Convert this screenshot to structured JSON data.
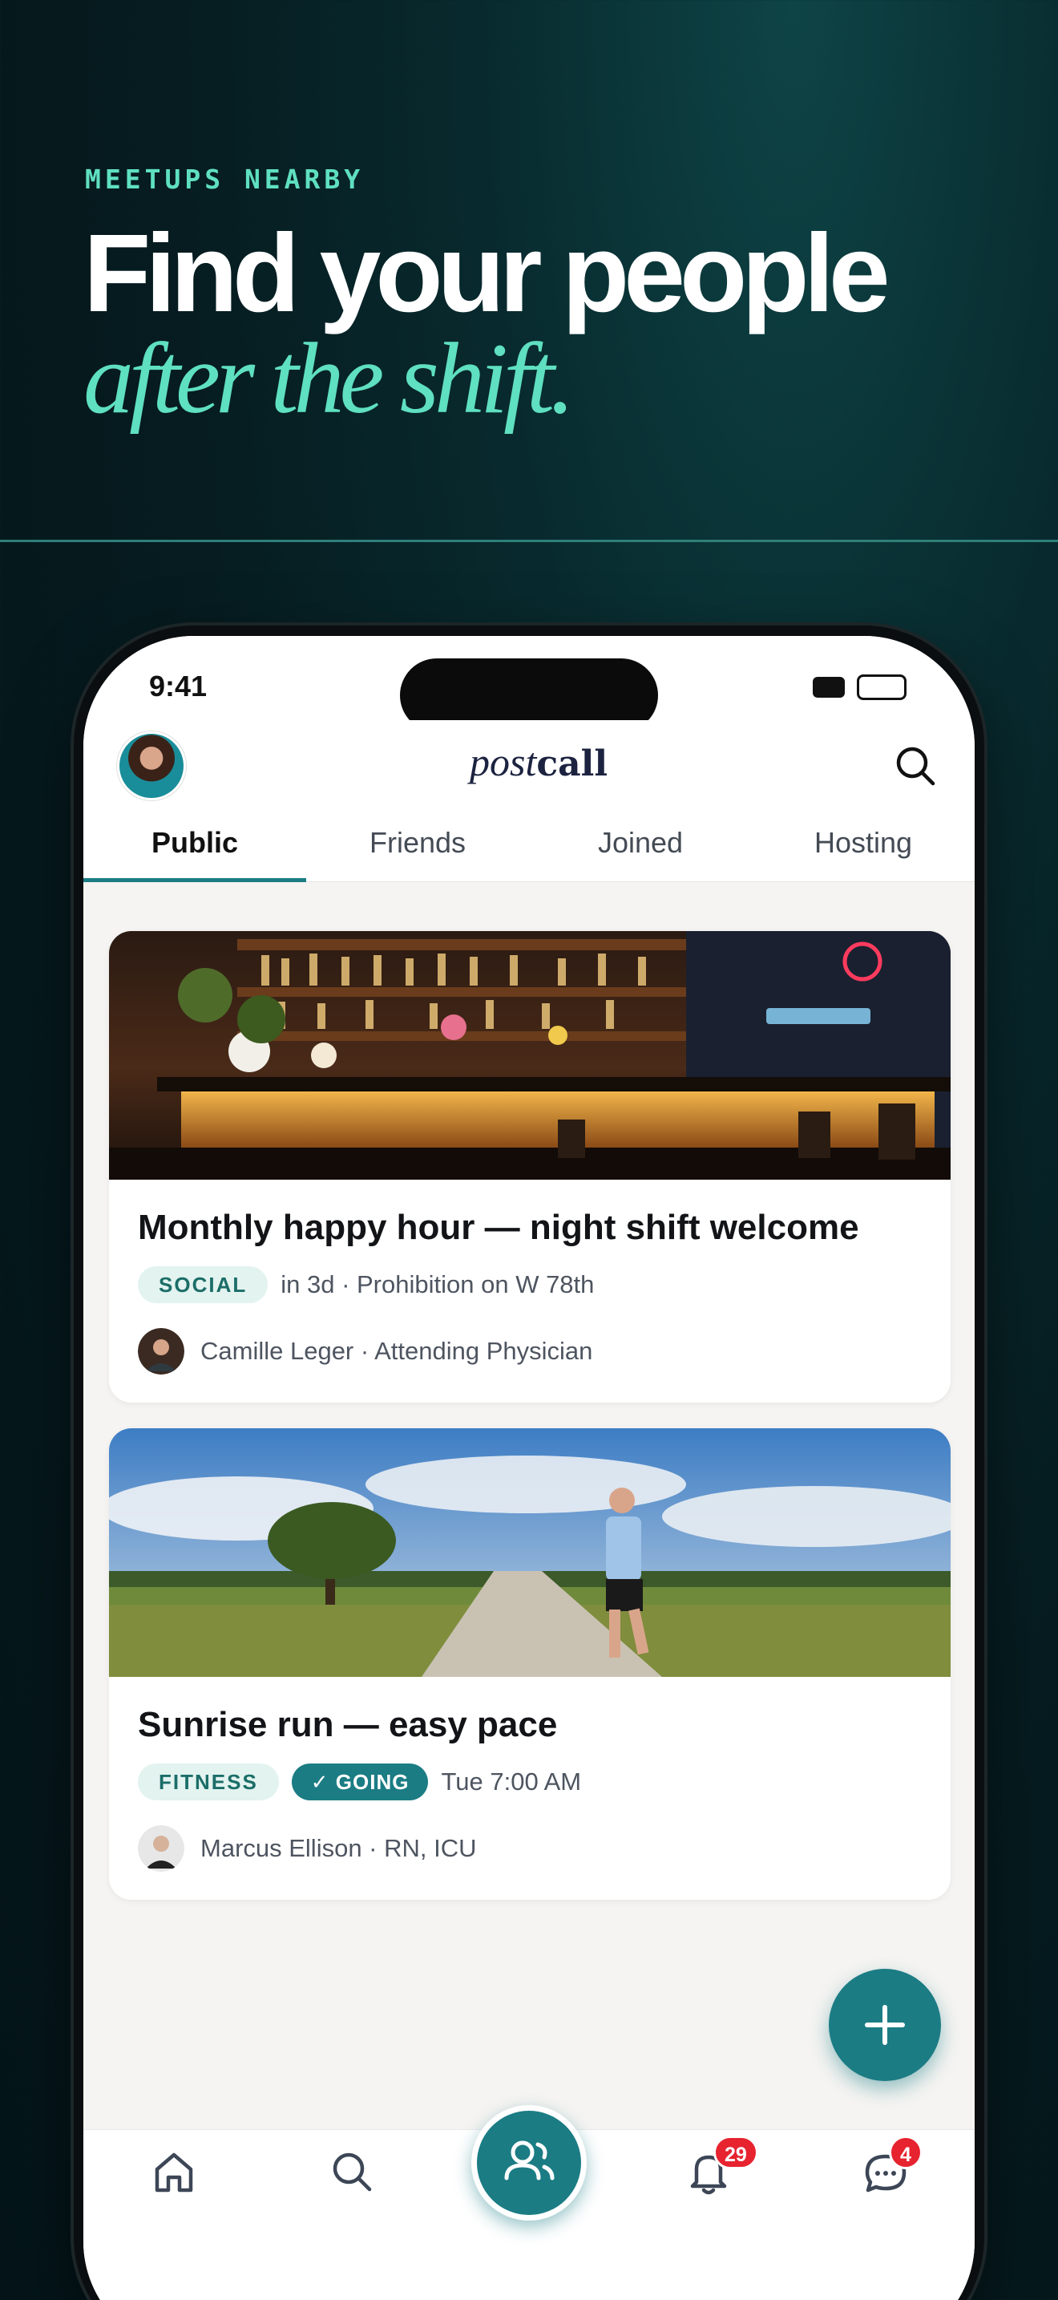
{
  "hero": {
    "eyebrow": "MEETUPS NEARBY",
    "headline": "Find your people",
    "subline": "after the shift."
  },
  "status_bar": {
    "time": "9:41"
  },
  "app": {
    "logo_part1": "post",
    "logo_part2": "call"
  },
  "tabs": [
    {
      "label": "Public",
      "active": true
    },
    {
      "label": "Friends",
      "active": false
    },
    {
      "label": "Joined",
      "active": false
    },
    {
      "label": "Hosting",
      "active": false
    }
  ],
  "events": [
    {
      "title": "Monthly happy hour — night shift welcome",
      "category": "SOCIAL",
      "going": false,
      "when_where": "in 3d · Prohibition on W 78th",
      "host": "Camille Leger · Attending Physician",
      "image": "bar-interior-photo"
    },
    {
      "title": "Sunrise run — easy pace",
      "category": "FITNESS",
      "going": true,
      "going_label": "✓ GOING",
      "when_where": "Tue 7:00 AM",
      "host": "Marcus Ellison · RN, ICU",
      "image": "runner-on-trail-photo"
    }
  ],
  "bottom_nav": {
    "items": [
      "home-icon",
      "search-icon",
      "people-icon",
      "bell-icon",
      "chat-icon"
    ],
    "notifications_badge": "29",
    "messages_badge": "4"
  },
  "colors": {
    "accent": "#1b7c84",
    "mint": "#5fe0c0",
    "badge": "#e6232f",
    "background_dark": "#061c20"
  }
}
